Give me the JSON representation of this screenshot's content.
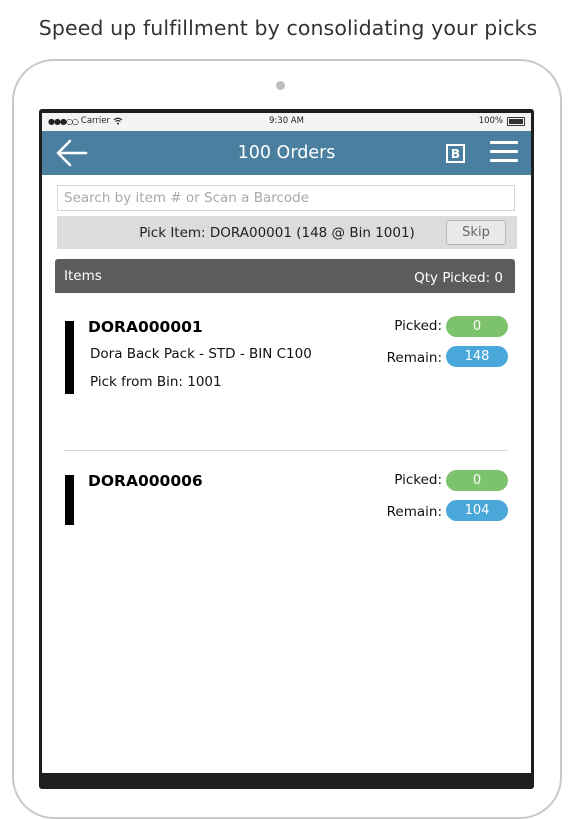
{
  "headline": "Speed up fulfillment by consolidating your picks",
  "status": {
    "carrier": "Carrier",
    "time": "9:30 AM",
    "battery": "100%"
  },
  "nav": {
    "title": "100 Orders",
    "barcode_button": "B"
  },
  "search": {
    "placeholder": "Search by item # or Scan a Barcode",
    "value": ""
  },
  "pick": {
    "text": "Pick Item: DORA00001 (148 @ Bin 1001)",
    "skip_label": "Skip"
  },
  "items_header": {
    "title": "Items",
    "qty_picked": "Qty Picked: 0"
  },
  "items": [
    {
      "sku": "DORA000001",
      "description": "Dora Back Pack - STD - BIN C100",
      "bin": "Pick from Bin: 1001",
      "picked_label": "Picked:",
      "picked": "0",
      "remain_label": "Remain:",
      "remain": "148"
    },
    {
      "sku": "DORA000006",
      "picked_label": "Picked:",
      "picked": "0",
      "remain_label": "Remain:",
      "remain": "104"
    }
  ],
  "colors": {
    "navbar": "#4a7fa0",
    "picked_pill": "#7dc26d",
    "remain_pill": "#4aa7d9",
    "items_header": "#5c5c5c"
  },
  "icons": [
    "back-arrow-icon",
    "barcode-b-icon",
    "hamburger-menu-icon",
    "wifi-icon",
    "battery-icon",
    "signal-dots-icon"
  ]
}
